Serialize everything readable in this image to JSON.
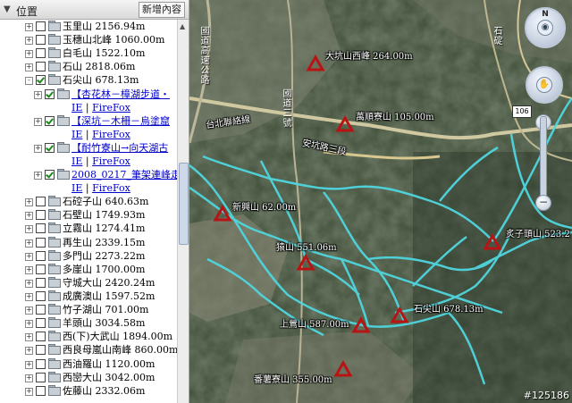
{
  "panel": {
    "title": "位置",
    "add_button": "新增內容"
  },
  "tree_top": [
    {
      "label": "玉里山 2156.94m"
    },
    {
      "label": "玉穗山北峰 1060.00m"
    },
    {
      "label": "白毛山 1522.10m"
    },
    {
      "label": "石山 2818.06m"
    }
  ],
  "tree_open": {
    "label": "石尖山 678.13m"
  },
  "tree_children": [
    {
      "line1": "【杏花林－樟湖步道・",
      "line2_a": "IE",
      "line2_sep": " | ",
      "line2_b": "FireFox"
    },
    {
      "line1": "【深坑－木柵－烏塗窟",
      "line2_a": "IE",
      "line2_sep": " | ",
      "line2_b": "FireFox"
    },
    {
      "line1": "【耐竹寮山→向天湖古",
      "line2_a": "IE",
      "line2_sep": " | ",
      "line2_b": "FireFox"
    },
    {
      "line1": "2008_0217_筆架連峰走二",
      "line2_a": "IE",
      "line2_sep": " | ",
      "line2_b": "FireFox"
    }
  ],
  "tree_rest": [
    {
      "label": "石硿子山 640.63m"
    },
    {
      "label": "石壁山 1749.93m"
    },
    {
      "label": "立霧山 1274.41m"
    },
    {
      "label": "再生山 2339.15m"
    },
    {
      "label": "多門山 2273.22m"
    },
    {
      "label": "多崖山 1700.00m"
    },
    {
      "label": "守城大山 2420.24m"
    },
    {
      "label": "成廣澳山 1597.52m"
    },
    {
      "label": "竹子湖山 701.00m"
    },
    {
      "label": "羊頭山 3034.58m"
    },
    {
      "label": "西(下)大武山 1894.00m"
    },
    {
      "label": "西良母嵐山南峰 860.00m"
    },
    {
      "label": "西油羅山 1120.00m"
    },
    {
      "label": "西巒大山 3042.00m"
    },
    {
      "label": "佐藤山 2332.06m"
    }
  ],
  "map_labels": {
    "p1": "大坑山西峰 264.00m",
    "p2": "萬順寮山 105.00m",
    "p3": "新興山 62.00m",
    "p4": "猿山 551.06m",
    "p5": "炙子頭山 523.2",
    "p6": "上鶯山 587.00m",
    "p7": "石尖山 678.13m",
    "p8": "番薯寮山 355.00m"
  },
  "road_labels": {
    "r1": "國道高速公路",
    "r2": "台北聯絡線",
    "r3": "國道三號",
    "r4": "安坑路三段",
    "r5": "石碇"
  },
  "map_ui": {
    "badge": "106",
    "north": "N",
    "zoom_in": "+",
    "zoom_out": "−"
  },
  "watermark": "#125186",
  "colors": {
    "track": "#4fd6df",
    "marker": "#b81414",
    "link": "#0000cc"
  }
}
